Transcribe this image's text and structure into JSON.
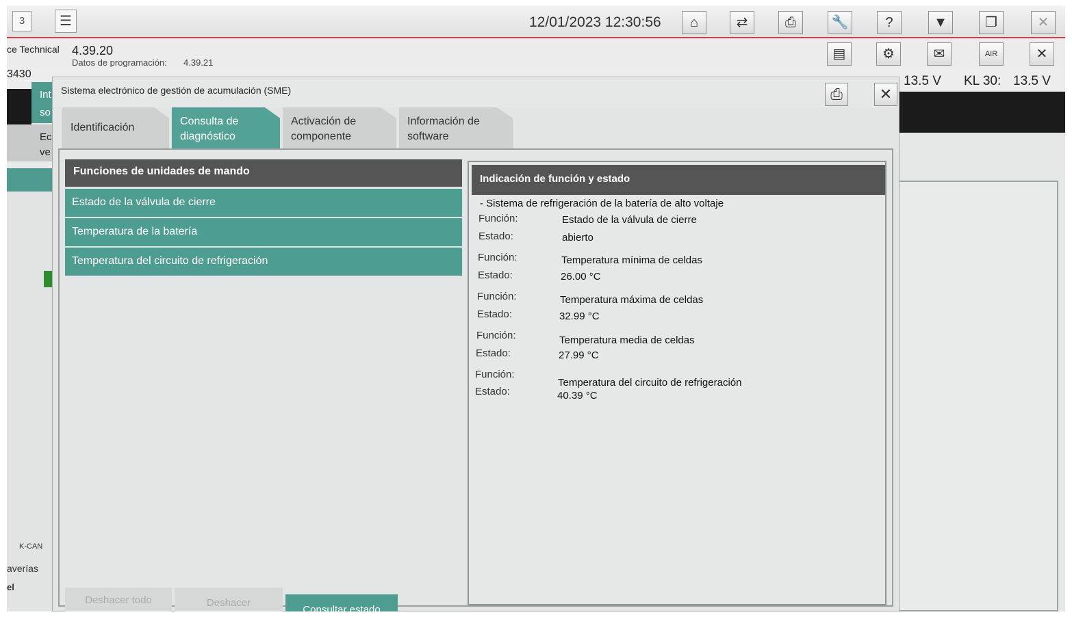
{
  "topbar": {
    "session_number": "3",
    "datetime": "12/01/2023 12:30:56",
    "help_label": "?",
    "air_label": "AIR"
  },
  "infobar": {
    "app_name": "ce Technical",
    "version": "4.39.20",
    "programming_label": "Datos de programación:",
    "programming_version": "4.39.21"
  },
  "vehicle": {
    "id_fragment": "3430",
    "voltage_1_value": "13.5 V",
    "voltage_2_label": "KL 30:",
    "voltage_2_value": "13.5 V"
  },
  "background": {
    "tab_fragment_1": "Int",
    "tab_fragment_2": "so",
    "tab_fragment_3": "Ec",
    "tab_fragment_4": "ve",
    "kcan_label": "K-CAN",
    "averias_fragment": "averías",
    "el_fragment": "el"
  },
  "dialog": {
    "title": "Sistema electrónico de gestión de acumulación (SME)",
    "tabs": [
      {
        "label_line1": "Identificación",
        "label_line2": ""
      },
      {
        "label_line1": "Consulta de",
        "label_line2": "diagnóstico"
      },
      {
        "label_line1": "Activación de",
        "label_line2": "componente"
      },
      {
        "label_line1": "Información de",
        "label_line2": "software"
      }
    ],
    "functions_header": "Funciones de unidades de mando",
    "functions": [
      "Estado de la válvula de cierre",
      "Temperatura de la batería",
      "Temperatura del circuito de refrigeración"
    ],
    "status_header": "Indicación de función y estado",
    "status_system": "- Sistema de refrigeración de la batería de alto voltaje",
    "function_label": "Función:",
    "status_label": "Estado:",
    "results": [
      {
        "function": "Estado de la válvula de cierre",
        "status": "abierto"
      },
      {
        "function": "Temperatura mínima de celdas",
        "status": "26.00 °C"
      },
      {
        "function": "Temperatura máxima de celdas",
        "status": "32.99 °C"
      },
      {
        "function": "Temperatura media de celdas",
        "status": "27.99 °C"
      },
      {
        "function": "Temperatura del circuito de refrigeración",
        "status": "40.39 °C"
      }
    ],
    "buttons": {
      "undo_all": "Deshacer todo",
      "undo": "Deshacer",
      "query_status": "Consultar estado"
    }
  }
}
